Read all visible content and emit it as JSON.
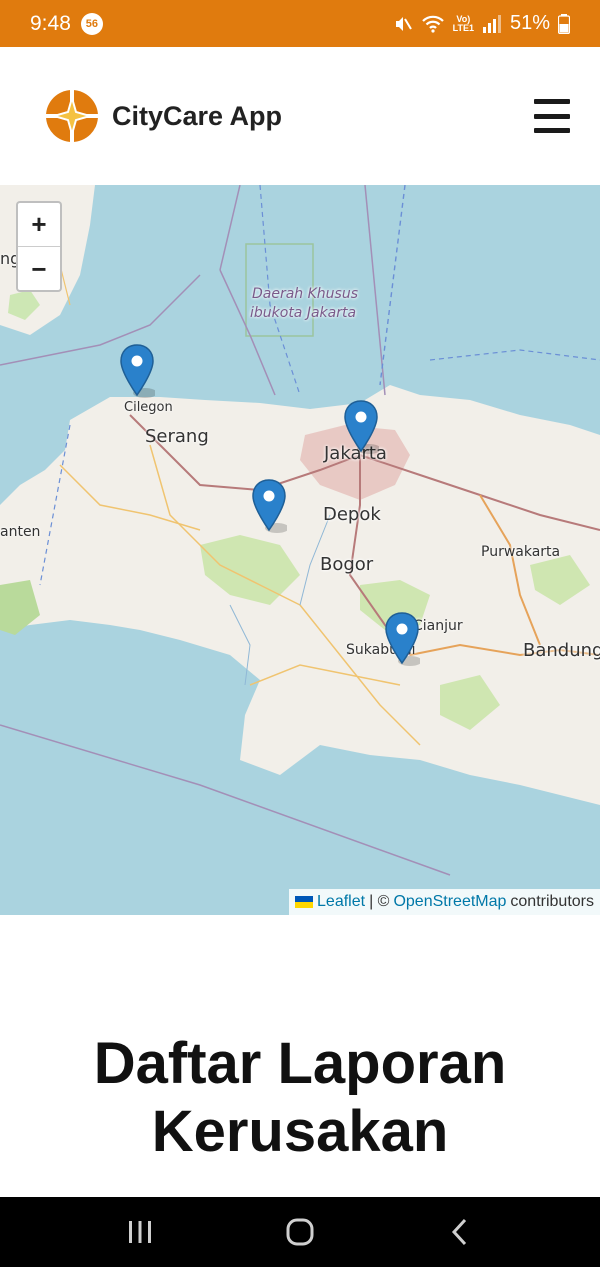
{
  "status_bar": {
    "time": "9:48",
    "notification_count": "56",
    "volte_label": "Vo)\nLTE1",
    "battery_percent": "51%",
    "background_color": "#e07b0e"
  },
  "header": {
    "app_title": "CityCare App",
    "logo_icon": "compass-star-icon",
    "menu_icon": "hamburger-menu-icon"
  },
  "map": {
    "zoom_in_label": "+",
    "zoom_out_label": "−",
    "places": {
      "cilegon": "Cilegon",
      "serang": "Serang",
      "jakarta": "Jakarta",
      "depok": "Depok",
      "bogor": "Bogor",
      "purwakarta": "Purwakarta",
      "cianjur": "Cianjur",
      "sukabumi": "Sukabumi",
      "bandung": "Bandung",
      "banten": "anten",
      "edge_left": "ng",
      "dki_line1": "Daerah Khusus",
      "dki_line2": "ibukota Jakarta"
    },
    "markers": [
      "Cilegon",
      "Jakarta",
      "Bogor area",
      "Sukabumi"
    ],
    "marker_color": "#2a81cb",
    "attribution": {
      "leaflet": "Leaflet",
      "separator": "| ©",
      "osm": "OpenStreetMap",
      "contributors": "contributors"
    }
  },
  "section": {
    "title_line1": "Daftar Laporan",
    "title_line2": "Kerusakan"
  },
  "nav_bar": {
    "recents_icon": "recent-apps-icon",
    "home_icon": "home-icon",
    "back_icon": "back-icon"
  }
}
